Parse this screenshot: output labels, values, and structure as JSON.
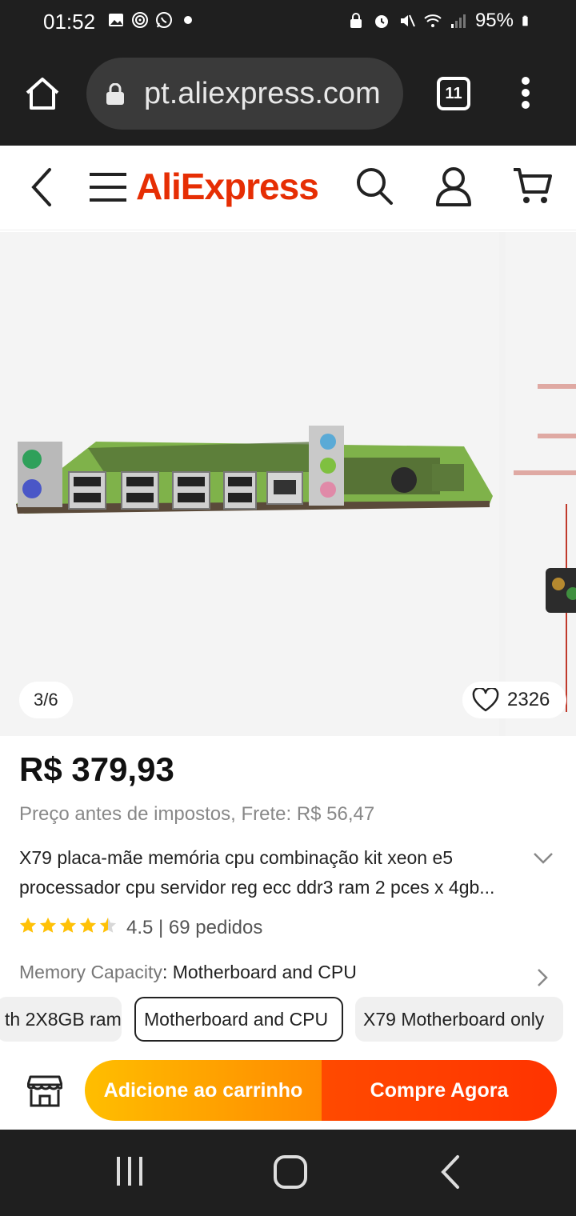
{
  "status_bar": {
    "time": "01:52",
    "battery": "95%"
  },
  "browser": {
    "url": "pt.aliexpress.com",
    "tab_count": "11"
  },
  "header": {
    "logo": "AliExpress"
  },
  "gallery": {
    "counter": "3/6",
    "wishlist_count": "2326"
  },
  "product": {
    "price": "R$ 379,93",
    "tax_shipping": "Preço antes de impostos, Frete: R$ 56,47",
    "title": "X79 placa-mãe memória cpu combinação kit xeon e5 processador cpu servidor reg ecc ddr3 ram 2 pces x 4gb...",
    "rating_value": 4.5,
    "rating_text": "4.5 | 69 pedidos",
    "variant_label": "Memory Capacity",
    "variant_value": ": Motherboard and CPU",
    "options": [
      {
        "label": "th 2X8GB ram",
        "selected": false
      },
      {
        "label": "Motherboard and CPU",
        "selected": true
      },
      {
        "label": "X79 Motherboard only",
        "selected": false
      }
    ]
  },
  "actions": {
    "add_to_cart": "Adicione ao carrinho",
    "buy_now": "Compre Agora"
  },
  "colors": {
    "brand": "#e62e04",
    "cart_gradient_start": "#ffbe00",
    "cart_gradient_end": "#ff8a00",
    "buy_gradient": "#ff3d00",
    "star": "#ffc107"
  }
}
